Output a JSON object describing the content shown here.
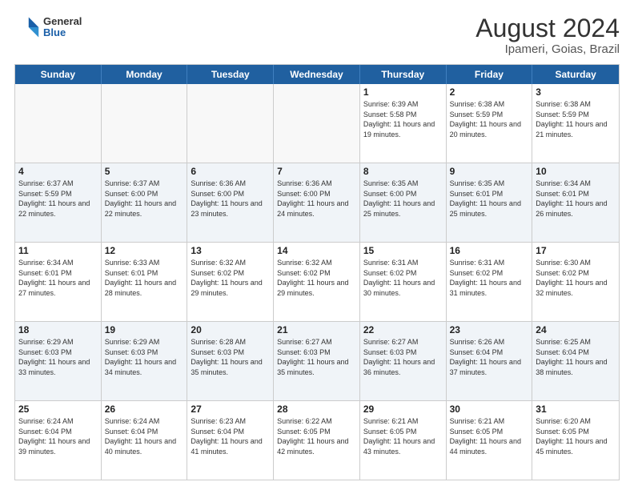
{
  "header": {
    "logo": {
      "general": "General",
      "blue": "Blue"
    },
    "title": "August 2024",
    "subtitle": "Ipameri, Goias, Brazil"
  },
  "calendar": {
    "days_of_week": [
      "Sunday",
      "Monday",
      "Tuesday",
      "Wednesday",
      "Thursday",
      "Friday",
      "Saturday"
    ],
    "weeks": [
      [
        {
          "day": "",
          "info": ""
        },
        {
          "day": "",
          "info": ""
        },
        {
          "day": "",
          "info": ""
        },
        {
          "day": "",
          "info": ""
        },
        {
          "day": "1",
          "info": "Sunrise: 6:39 AM\nSunset: 5:58 PM\nDaylight: 11 hours and 19 minutes."
        },
        {
          "day": "2",
          "info": "Sunrise: 6:38 AM\nSunset: 5:59 PM\nDaylight: 11 hours and 20 minutes."
        },
        {
          "day": "3",
          "info": "Sunrise: 6:38 AM\nSunset: 5:59 PM\nDaylight: 11 hours and 21 minutes."
        }
      ],
      [
        {
          "day": "4",
          "info": "Sunrise: 6:37 AM\nSunset: 5:59 PM\nDaylight: 11 hours and 22 minutes."
        },
        {
          "day": "5",
          "info": "Sunrise: 6:37 AM\nSunset: 6:00 PM\nDaylight: 11 hours and 22 minutes."
        },
        {
          "day": "6",
          "info": "Sunrise: 6:36 AM\nSunset: 6:00 PM\nDaylight: 11 hours and 23 minutes."
        },
        {
          "day": "7",
          "info": "Sunrise: 6:36 AM\nSunset: 6:00 PM\nDaylight: 11 hours and 24 minutes."
        },
        {
          "day": "8",
          "info": "Sunrise: 6:35 AM\nSunset: 6:00 PM\nDaylight: 11 hours and 25 minutes."
        },
        {
          "day": "9",
          "info": "Sunrise: 6:35 AM\nSunset: 6:01 PM\nDaylight: 11 hours and 25 minutes."
        },
        {
          "day": "10",
          "info": "Sunrise: 6:34 AM\nSunset: 6:01 PM\nDaylight: 11 hours and 26 minutes."
        }
      ],
      [
        {
          "day": "11",
          "info": "Sunrise: 6:34 AM\nSunset: 6:01 PM\nDaylight: 11 hours and 27 minutes."
        },
        {
          "day": "12",
          "info": "Sunrise: 6:33 AM\nSunset: 6:01 PM\nDaylight: 11 hours and 28 minutes."
        },
        {
          "day": "13",
          "info": "Sunrise: 6:32 AM\nSunset: 6:02 PM\nDaylight: 11 hours and 29 minutes."
        },
        {
          "day": "14",
          "info": "Sunrise: 6:32 AM\nSunset: 6:02 PM\nDaylight: 11 hours and 29 minutes."
        },
        {
          "day": "15",
          "info": "Sunrise: 6:31 AM\nSunset: 6:02 PM\nDaylight: 11 hours and 30 minutes."
        },
        {
          "day": "16",
          "info": "Sunrise: 6:31 AM\nSunset: 6:02 PM\nDaylight: 11 hours and 31 minutes."
        },
        {
          "day": "17",
          "info": "Sunrise: 6:30 AM\nSunset: 6:02 PM\nDaylight: 11 hours and 32 minutes."
        }
      ],
      [
        {
          "day": "18",
          "info": "Sunrise: 6:29 AM\nSunset: 6:03 PM\nDaylight: 11 hours and 33 minutes."
        },
        {
          "day": "19",
          "info": "Sunrise: 6:29 AM\nSunset: 6:03 PM\nDaylight: 11 hours and 34 minutes."
        },
        {
          "day": "20",
          "info": "Sunrise: 6:28 AM\nSunset: 6:03 PM\nDaylight: 11 hours and 35 minutes."
        },
        {
          "day": "21",
          "info": "Sunrise: 6:27 AM\nSunset: 6:03 PM\nDaylight: 11 hours and 35 minutes."
        },
        {
          "day": "22",
          "info": "Sunrise: 6:27 AM\nSunset: 6:03 PM\nDaylight: 11 hours and 36 minutes."
        },
        {
          "day": "23",
          "info": "Sunrise: 6:26 AM\nSunset: 6:04 PM\nDaylight: 11 hours and 37 minutes."
        },
        {
          "day": "24",
          "info": "Sunrise: 6:25 AM\nSunset: 6:04 PM\nDaylight: 11 hours and 38 minutes."
        }
      ],
      [
        {
          "day": "25",
          "info": "Sunrise: 6:24 AM\nSunset: 6:04 PM\nDaylight: 11 hours and 39 minutes."
        },
        {
          "day": "26",
          "info": "Sunrise: 6:24 AM\nSunset: 6:04 PM\nDaylight: 11 hours and 40 minutes."
        },
        {
          "day": "27",
          "info": "Sunrise: 6:23 AM\nSunset: 6:04 PM\nDaylight: 11 hours and 41 minutes."
        },
        {
          "day": "28",
          "info": "Sunrise: 6:22 AM\nSunset: 6:05 PM\nDaylight: 11 hours and 42 minutes."
        },
        {
          "day": "29",
          "info": "Sunrise: 6:21 AM\nSunset: 6:05 PM\nDaylight: 11 hours and 43 minutes."
        },
        {
          "day": "30",
          "info": "Sunrise: 6:21 AM\nSunset: 6:05 PM\nDaylight: 11 hours and 44 minutes."
        },
        {
          "day": "31",
          "info": "Sunrise: 6:20 AM\nSunset: 6:05 PM\nDaylight: 11 hours and 45 minutes."
        }
      ]
    ]
  }
}
